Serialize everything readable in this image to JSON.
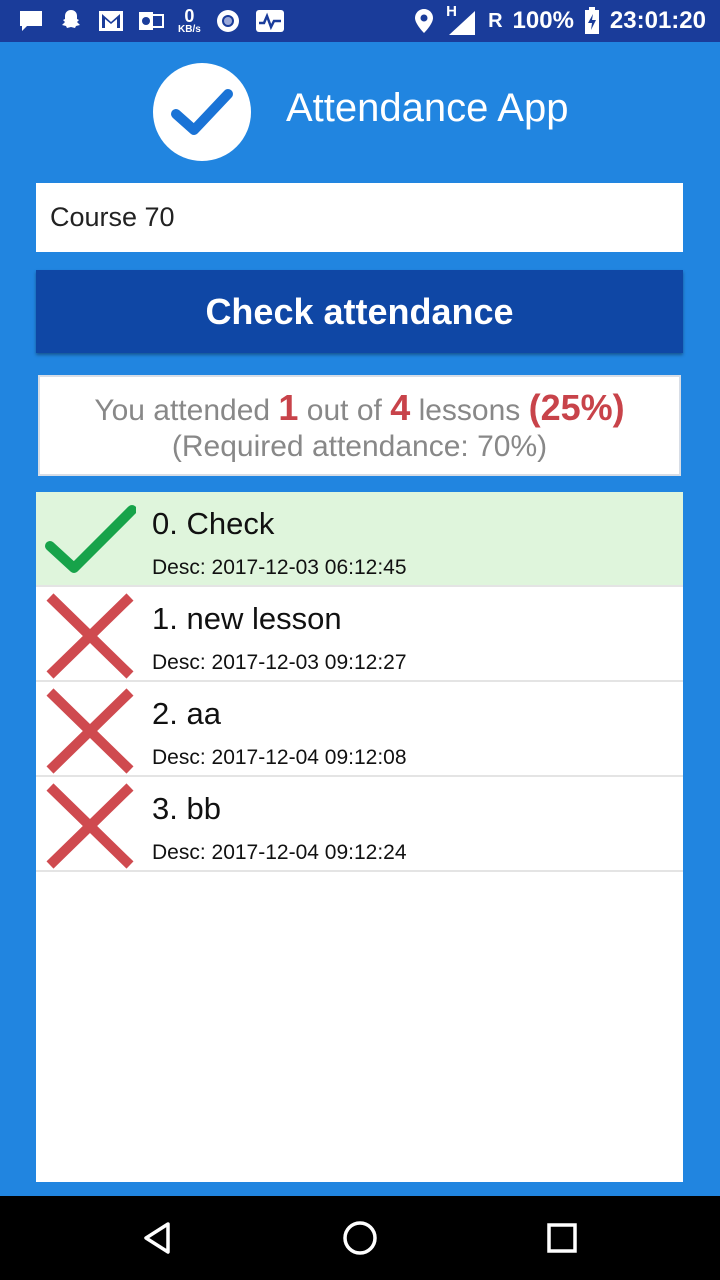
{
  "status_bar": {
    "kbs_value": "0",
    "kbs_unit": "KB/s",
    "network_h": "H",
    "roaming": "R",
    "battery": "100%",
    "time": "23:01:20",
    "icons": [
      "chat-icon",
      "snapchat-icon",
      "gmail-icon",
      "outlook-icon",
      "speed-icon",
      "circle-app-icon",
      "pulse-icon",
      "location-icon",
      "signal-icon",
      "battery-charging-icon"
    ]
  },
  "header": {
    "title": "Attendance App",
    "logo_icon": "checkmark-icon"
  },
  "course_input": {
    "value": "Course 70"
  },
  "check_button": {
    "label": "Check attendance"
  },
  "summary": {
    "prefix": "You attended",
    "attended": "1",
    "middle": "out of",
    "total": "4",
    "suffix": "lessons",
    "percent": "(25%)",
    "required": "(Required attendance: 70%)"
  },
  "lessons": [
    {
      "title": "0. Check",
      "desc": "Desc: 2017-12-03 06:12:45",
      "attended": true
    },
    {
      "title": "1. new lesson",
      "desc": "Desc: 2017-12-03 09:12:27",
      "attended": false
    },
    {
      "title": "2. aa",
      "desc": "Desc: 2017-12-04 09:12:08",
      "attended": false
    },
    {
      "title": "3. bb",
      "desc": "Desc: 2017-12-04 09:12:24",
      "attended": false
    }
  ],
  "colors": {
    "background": "#2185e0",
    "status_bar": "#1a3c9a",
    "button": "#0f47a5",
    "attended_row": "#dff5dc",
    "check_green": "#17a34a",
    "cross_red": "#cf4a4f",
    "highlight_red": "#c8434a"
  },
  "nav_bar": {
    "icons": [
      "back-icon",
      "home-icon",
      "recents-icon"
    ]
  }
}
